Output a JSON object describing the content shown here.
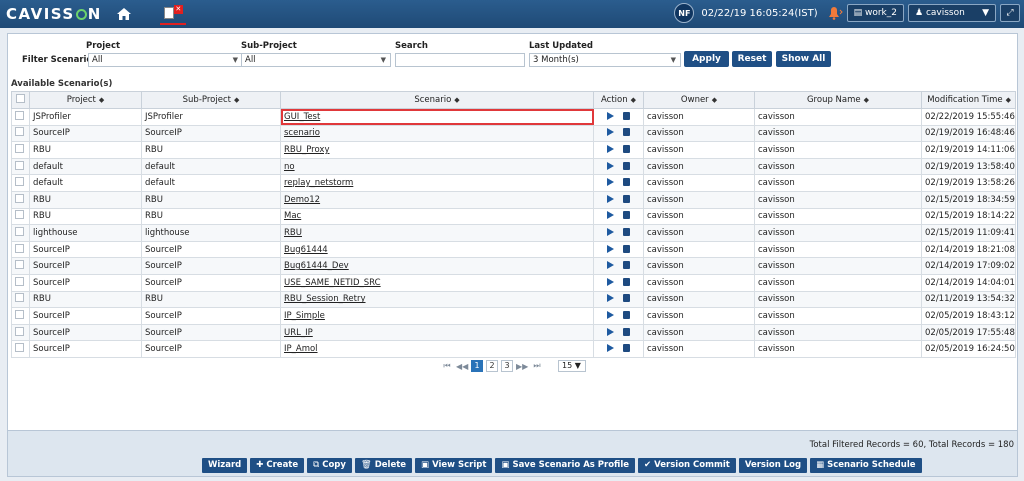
{
  "topbar": {
    "logo_text_1": "CAVISS",
    "logo_text_2": "N",
    "avatar_initials": "NF",
    "datetime": "02/22/19 16:05:24(IST)",
    "workspace_btn": "work_2",
    "user_btn": "cavisson"
  },
  "filters": {
    "label": "Filter Scenarios:",
    "project_label": "Project",
    "project_value": "All",
    "subproject_label": "Sub-Project",
    "subproject_value": "All",
    "search_label": "Search",
    "search_value": "",
    "updated_label": "Last Updated",
    "updated_value": "3 Month(s)",
    "apply": "Apply",
    "reset": "Reset",
    "show_all": "Show All"
  },
  "table": {
    "title": "Available Scenario(s)",
    "columns": [
      "Project",
      "Sub-Project",
      "Scenario",
      "Action",
      "Owner",
      "Group Name",
      "Modification Time"
    ],
    "rows": [
      [
        "JSProfiler",
        "JSProfiler",
        "GUI_Test",
        "cavisson",
        "cavisson",
        "02/22/2019 15:55:46"
      ],
      [
        "SourceIP",
        "SourceIP",
        "scenario",
        "cavisson",
        "cavisson",
        "02/19/2019 16:48:46"
      ],
      [
        "RBU",
        "RBU",
        "RBU_Proxy",
        "cavisson",
        "cavisson",
        "02/19/2019 14:11:06"
      ],
      [
        "default",
        "default",
        "no",
        "cavisson",
        "cavisson",
        "02/19/2019 13:58:40"
      ],
      [
        "default",
        "default",
        "replay_netstorm",
        "cavisson",
        "cavisson",
        "02/19/2019 13:58:26"
      ],
      [
        "RBU",
        "RBU",
        "Demo12",
        "cavisson",
        "cavisson",
        "02/15/2019 18:34:59"
      ],
      [
        "RBU",
        "RBU",
        "Mac",
        "cavisson",
        "cavisson",
        "02/15/2019 18:14:22"
      ],
      [
        "lighthouse",
        "lighthouse",
        "RBU",
        "cavisson",
        "cavisson",
        "02/15/2019 11:09:41"
      ],
      [
        "SourceIP",
        "SourceIP",
        "Bug61444",
        "cavisson",
        "cavisson",
        "02/14/2019 18:21:08"
      ],
      [
        "SourceIP",
        "SourceIP",
        "Bug61444_Dev",
        "cavisson",
        "cavisson",
        "02/14/2019 17:09:02"
      ],
      [
        "SourceIP",
        "SourceIP",
        "USE_SAME_NETID_SRC",
        "cavisson",
        "cavisson",
        "02/14/2019 14:04:01"
      ],
      [
        "RBU",
        "RBU",
        "RBU_Session_Retry",
        "cavisson",
        "cavisson",
        "02/11/2019 13:54:32"
      ],
      [
        "SourceIP",
        "SourceIP",
        "IP_Simple",
        "cavisson",
        "cavisson",
        "02/05/2019 18:43:12"
      ],
      [
        "SourceIP",
        "SourceIP",
        "URL_IP",
        "cavisson",
        "cavisson",
        "02/05/2019 17:55:48"
      ],
      [
        "SourceIP",
        "SourceIP",
        "IP_Amol",
        "cavisson",
        "cavisson",
        "02/05/2019 16:24:50"
      ]
    ]
  },
  "pager": {
    "pages": [
      "1",
      "2",
      "3"
    ],
    "active": "1",
    "page_size": "15"
  },
  "records": "Total Filtered Records = 60, Total Records = 180",
  "actions": {
    "wizard": "Wizard",
    "create": "Create",
    "copy": "Copy",
    "delete": "Delete",
    "view_script": "View Script",
    "save_profile": "Save Scenario As Profile",
    "version_commit": "Version Commit",
    "version_log": "Version Log",
    "scenario_schedule": "Scenario Schedule"
  },
  "colors": {
    "brand": "#1f4a76",
    "button": "#1f4f85",
    "selection": "#e0383a"
  }
}
